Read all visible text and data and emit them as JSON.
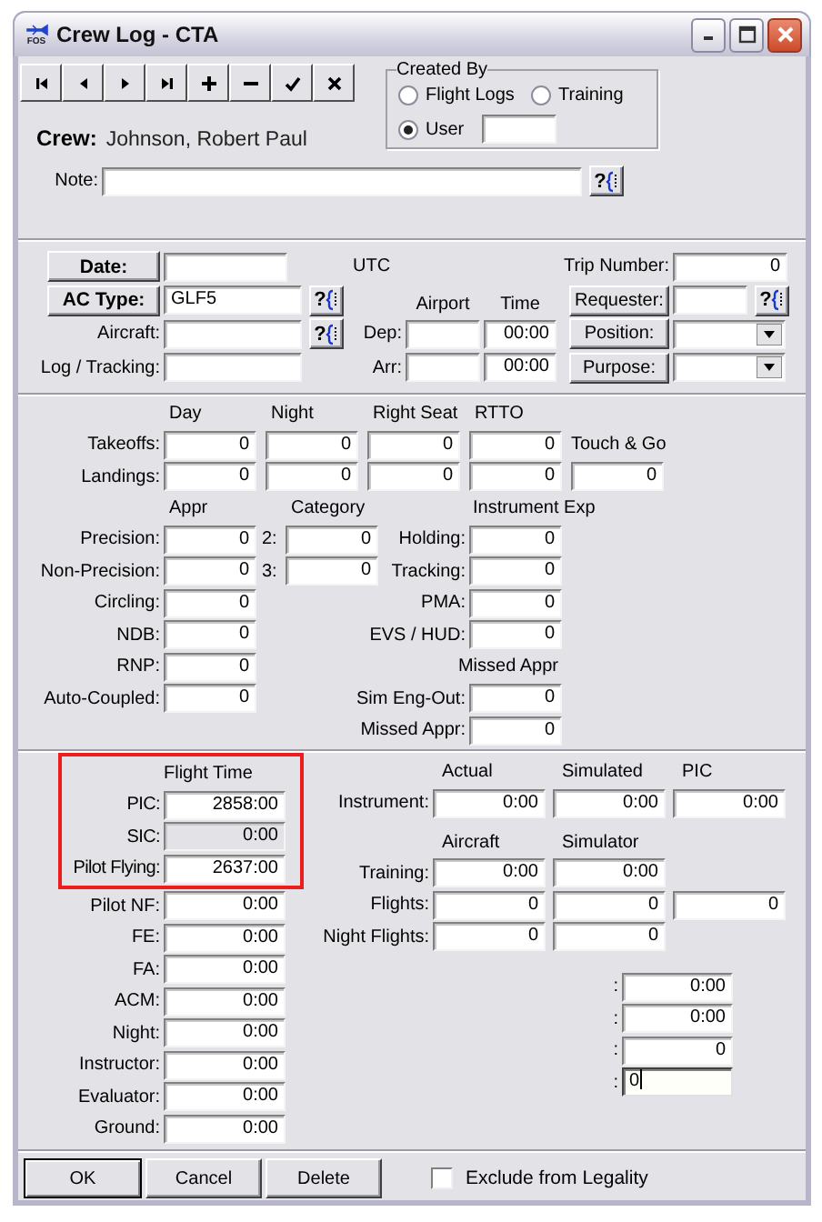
{
  "window": {
    "title": "Crew Log - CTA",
    "icon_text": "FOS"
  },
  "toolbar": [
    {
      "kind": "first"
    },
    {
      "kind": "prev"
    },
    {
      "kind": "next"
    },
    {
      "kind": "last"
    },
    {
      "kind": "add"
    },
    {
      "kind": "remove"
    },
    {
      "kind": "confirm"
    },
    {
      "kind": "cancel"
    }
  ],
  "created_by": {
    "title": "Created By",
    "options": [
      {
        "label": "Flight Logs",
        "selected": false
      },
      {
        "label": "Training",
        "selected": false
      },
      {
        "label": "User",
        "selected": true
      }
    ]
  },
  "crew": {
    "label": "Crew:",
    "name": "Johnson, Robert Paul"
  },
  "note": {
    "label": "Note:",
    "lookup": "?"
  },
  "trip": {
    "date": {
      "button": "Date:",
      "suffix": "UTC"
    },
    "ac_type": {
      "button": "AC Type:",
      "value": "GLF5",
      "lookup": "?"
    },
    "aircraft": {
      "label": "Aircraft:",
      "lookup": "?"
    },
    "log_tracking": {
      "label": "Log / Tracking:"
    },
    "columns": [
      "Airport",
      "Time"
    ],
    "legs": [
      {
        "label": "Dep:",
        "time": "00:00"
      },
      {
        "label": "Arr:",
        "time": "00:00"
      }
    ],
    "trip_number": {
      "label": "Trip Number:",
      "value": "0"
    },
    "requester": {
      "button": "Requester:",
      "lookup": "?"
    },
    "position": {
      "button": "Position:"
    },
    "purpose": {
      "button": "Purpose:"
    }
  },
  "landings": {
    "columns": [
      "Day",
      "Night",
      "Right Seat",
      "RTTO"
    ],
    "touch_go": "Touch & Go",
    "rows": [
      {
        "label": "Takeoffs:",
        "values": [
          "0",
          "0",
          "0",
          "0"
        ]
      },
      {
        "label": "Landings:",
        "values": [
          "0",
          "0",
          "0",
          "0",
          "0"
        ]
      }
    ]
  },
  "approaches": {
    "appr_header": "Appr",
    "category_header": "Category",
    "instrument_header": "Instrument Exp",
    "missed_header": "Missed Appr",
    "rows": [
      {
        "label": "Precision:",
        "value": "0"
      },
      {
        "label": "Non-Precision:",
        "value": "0"
      },
      {
        "label": "Circling:",
        "value": "0"
      },
      {
        "label": "NDB:",
        "value": "0"
      },
      {
        "label": "RNP:",
        "value": "0"
      },
      {
        "label": "Auto-Coupled:",
        "value": "0"
      }
    ],
    "category": [
      {
        "label": "2:",
        "value": "0"
      },
      {
        "label": "3:",
        "value": "0"
      }
    ],
    "instrument": [
      {
        "label": "Holding:",
        "value": "0"
      },
      {
        "label": "Tracking:",
        "value": "0"
      },
      {
        "label": "PMA:",
        "value": "0"
      },
      {
        "label": "EVS / HUD:",
        "value": "0"
      }
    ],
    "missed": [
      {
        "label": "Sim Eng-Out:",
        "value": "0"
      },
      {
        "label": "Missed Appr:",
        "value": "0"
      }
    ]
  },
  "flight_time": {
    "header": "Flight Time",
    "highlighted": true,
    "top_rows": [
      {
        "label": "PIC:",
        "value": "2858:00",
        "disabled": false
      },
      {
        "label": "SIC:",
        "value": "0:00",
        "disabled": true
      },
      {
        "label": "Pilot Flying:",
        "value": "2637:00",
        "disabled": false
      }
    ],
    "rows": [
      {
        "label": "Pilot NF:",
        "value": "0:00",
        "disabled": false
      },
      {
        "label": "FE:",
        "value": "0:00",
        "disabled": false
      },
      {
        "label": "FA:",
        "value": "0:00",
        "disabled": false
      },
      {
        "label": "ACM:",
        "value": "0:00",
        "disabled": false
      },
      {
        "label": "Night:",
        "value": "0:00",
        "disabled": false
      },
      {
        "label": "Instructor:",
        "value": "0:00",
        "disabled": false
      },
      {
        "label": "Evaluator:",
        "value": "0:00",
        "disabled": false
      },
      {
        "label": "Ground:",
        "value": "0:00",
        "disabled": false
      }
    ]
  },
  "instrument_time": {
    "columns": [
      "Actual",
      "Simulated",
      "PIC"
    ],
    "label": "Instrument:",
    "values": [
      "0:00",
      "0:00",
      "0:00"
    ]
  },
  "training": {
    "columns": [
      "Aircraft",
      "Simulator"
    ],
    "rows": [
      {
        "label": "Training:",
        "values": [
          "0:00",
          "0:00"
        ]
      },
      {
        "label": "Flights:",
        "values": [
          "0",
          "0",
          "0"
        ]
      },
      {
        "label": "Night Flights:",
        "values": [
          "0",
          "0"
        ]
      }
    ]
  },
  "extra": [
    {
      "label": ":",
      "value": "0:00",
      "focused": false
    },
    {
      "label": ":",
      "value": "0:00",
      "focused": false
    },
    {
      "label": ":",
      "value": "0",
      "focused": false
    },
    {
      "label": ":",
      "value": "0",
      "focused": true
    }
  ],
  "footer": {
    "buttons": [
      {
        "label": "OK",
        "default": true
      },
      {
        "label": "Cancel",
        "default": false
      },
      {
        "label": "Delete",
        "default": false
      }
    ],
    "exclude": {
      "label": "Exclude from Legality",
      "checked": false
    }
  }
}
